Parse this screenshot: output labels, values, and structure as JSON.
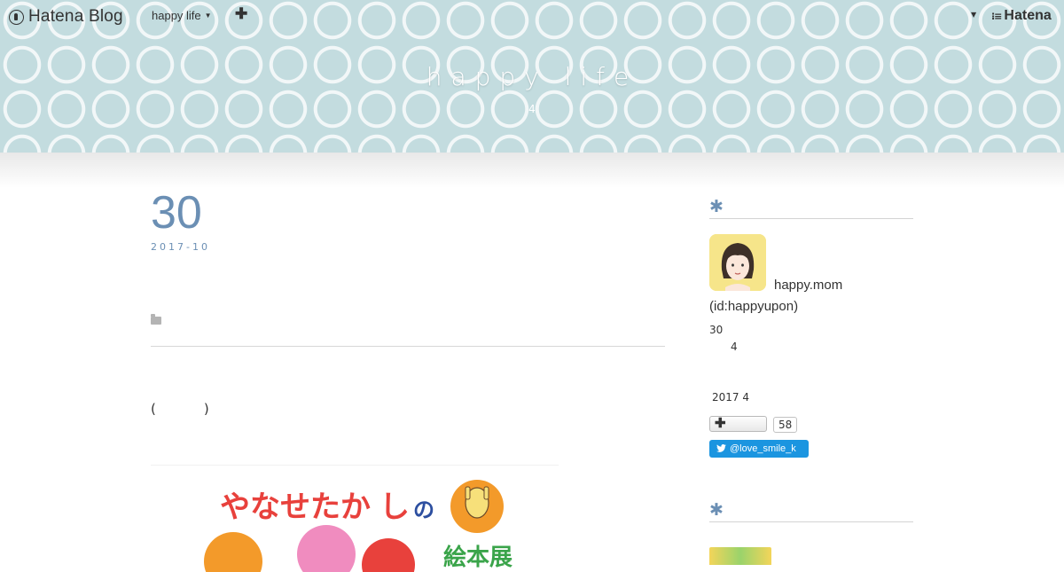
{
  "globalbar": {
    "logo_text": "Hatena Blog",
    "blog_switcher_label": "happy life",
    "add_icon": "plus-icon",
    "hatena_text": "Hatena"
  },
  "header": {
    "title": "happy life",
    "description": "4"
  },
  "entry": {
    "day": "30",
    "year_month": "2017-10",
    "category_icon": "folder-icon",
    "body_paren_open": "(",
    "body_paren_close": ")"
  },
  "sidebar": {
    "profile": {
      "heading_mark": "✱",
      "name": "happy.mom",
      "id": "(id:happyupon)",
      "line1": "30",
      "line2": "4",
      "since": "2017 4",
      "bookmark_count": "58",
      "twitter_handle": "@love_smile_k"
    },
    "module2": {
      "heading_mark": "✱"
    }
  },
  "colors": {
    "header_bg": "#c3dcdf",
    "accent": "#6b8fb4",
    "twitter": "#1b95e0"
  }
}
